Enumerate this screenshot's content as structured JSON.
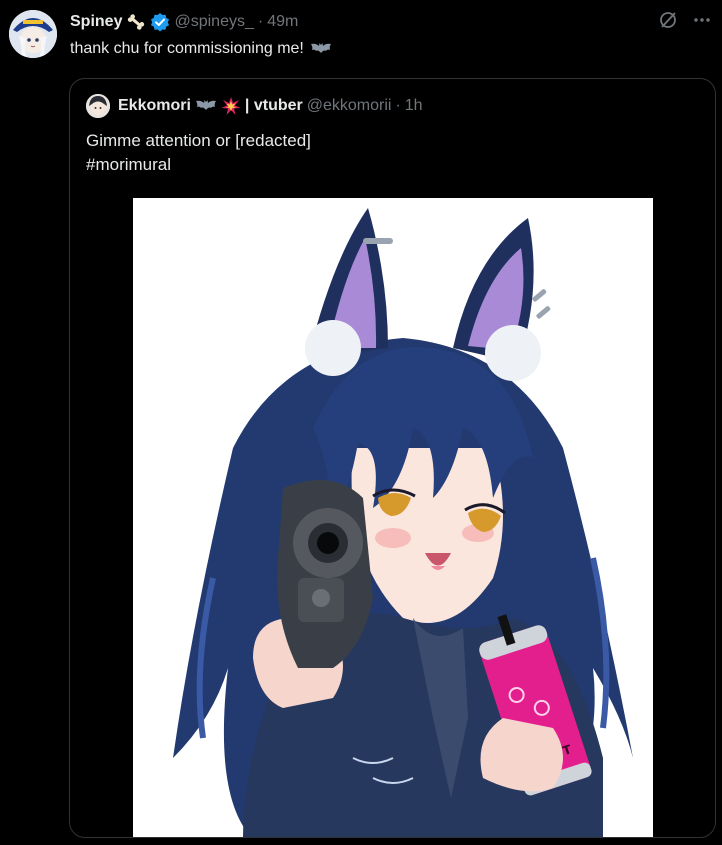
{
  "post": {
    "author_name": "Spiney",
    "author_handle": "@spineys_",
    "separator": "·",
    "time": "49m",
    "text": "thank chu for commissioning me!",
    "badges": [
      "bone-emoji-icon",
      "verified-badge-icon"
    ],
    "text_emoji": "bat-emoji-icon",
    "colors": {
      "verified": "#1d9bf0",
      "muted": "#71767b",
      "text": "#e7e9ea",
      "border": "#2f3336"
    }
  },
  "quoted_post": {
    "author_name": "Ekkomori",
    "name_suffix": "| vtuber",
    "author_handle": "@ekkomorii",
    "separator": "·",
    "time": "1h",
    "text_line1": "Gimme attention or [redacted]",
    "text_line2": "#morimural",
    "name_emoji": [
      "bat-emoji-icon",
      "explosion-emoji-icon"
    ],
    "media": {
      "kind": "illustration",
      "can_label": "MONST"
    }
  },
  "actions": [
    "grok-icon",
    "more-icon"
  ]
}
